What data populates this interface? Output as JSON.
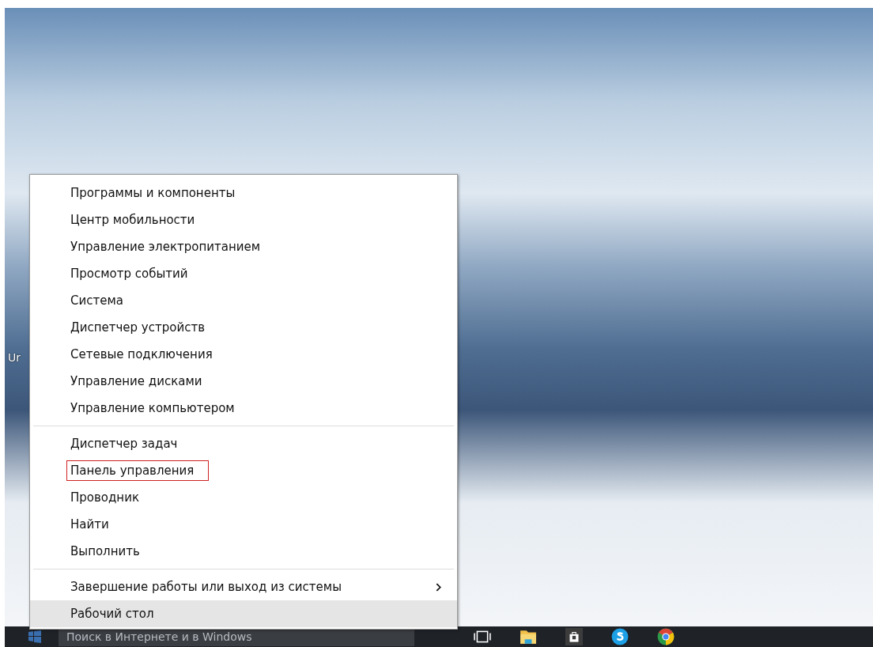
{
  "desktop": {
    "icon_label": "Ur"
  },
  "context_menu": {
    "groups": [
      {
        "items": [
          {
            "label": "Программы и компоненты",
            "selected": false,
            "outlined": false,
            "submenu": false
          },
          {
            "label": "Центр мобильности",
            "selected": false,
            "outlined": false,
            "submenu": false
          },
          {
            "label": "Управление электропитанием",
            "selected": false,
            "outlined": false,
            "submenu": false
          },
          {
            "label": "Просмотр событий",
            "selected": false,
            "outlined": false,
            "submenu": false
          },
          {
            "label": "Система",
            "selected": false,
            "outlined": false,
            "submenu": false
          },
          {
            "label": "Диспетчер устройств",
            "selected": false,
            "outlined": false,
            "submenu": false
          },
          {
            "label": "Сетевые подключения",
            "selected": false,
            "outlined": false,
            "submenu": false
          },
          {
            "label": "Управление дисками",
            "selected": false,
            "outlined": false,
            "submenu": false
          },
          {
            "label": "Управление компьютером",
            "selected": false,
            "outlined": false,
            "submenu": false
          }
        ]
      },
      {
        "items": [
          {
            "label": "Диспетчер задач",
            "selected": false,
            "outlined": false,
            "submenu": false
          },
          {
            "label": "Панель управления",
            "selected": false,
            "outlined": true,
            "submenu": false
          },
          {
            "label": "Проводник",
            "selected": false,
            "outlined": false,
            "submenu": false
          },
          {
            "label": "Найти",
            "selected": false,
            "outlined": false,
            "submenu": false
          },
          {
            "label": "Выполнить",
            "selected": false,
            "outlined": false,
            "submenu": false
          }
        ]
      },
      {
        "items": [
          {
            "label": "Завершение работы или выход из системы",
            "selected": false,
            "outlined": false,
            "submenu": true
          },
          {
            "label": "Рабочий стол",
            "selected": true,
            "outlined": false,
            "submenu": false
          }
        ]
      }
    ]
  },
  "taskbar": {
    "search": {
      "placeholder": "Поиск в Интернете и в Windows"
    },
    "apps": [
      {
        "kind": "taskview"
      },
      {
        "kind": "explorer"
      },
      {
        "kind": "store"
      },
      {
        "kind": "skype"
      },
      {
        "kind": "chrome"
      }
    ]
  }
}
